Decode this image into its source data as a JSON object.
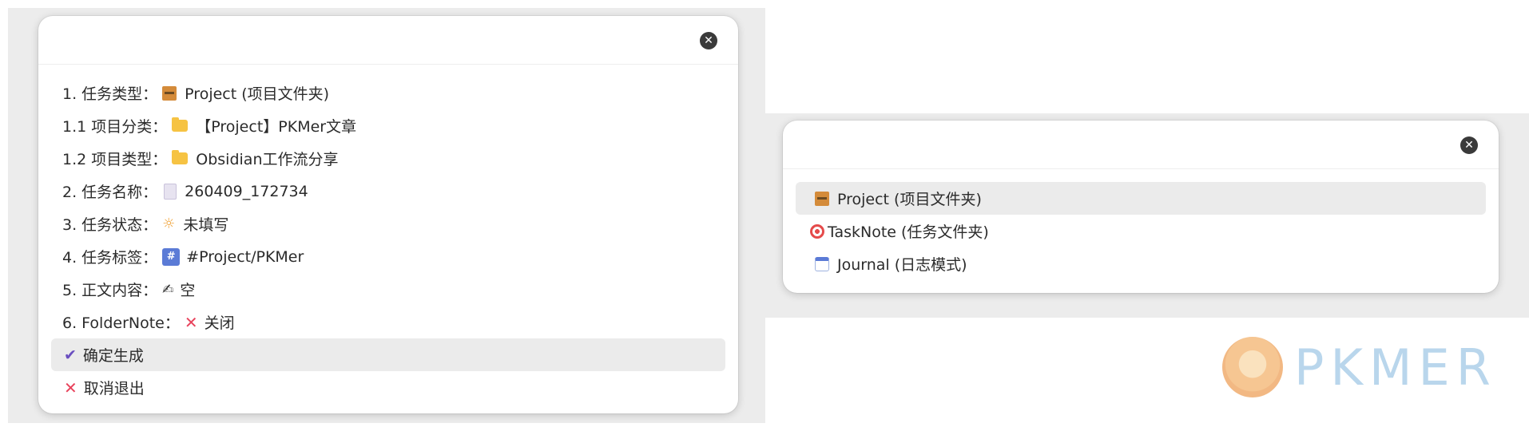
{
  "left_dialog": {
    "items": [
      {
        "prefix": "1. 任务类型：",
        "icon": "file-cabinet-icon",
        "value": "Project (项目文件夹)"
      },
      {
        "prefix": "1.1 项目分类：",
        "icon": "folder-icon",
        "value": "【Project】PKMer文章"
      },
      {
        "prefix": "1.2 项目类型：",
        "icon": "folder-icon",
        "value": "Obsidian工作流分享"
      },
      {
        "prefix": "2. 任务名称：",
        "icon": "page-icon",
        "value": "260409_172734"
      },
      {
        "prefix": "3. 任务状态：",
        "icon": "sun-icon",
        "value": "未填写"
      },
      {
        "prefix": "4. 任务标签：",
        "icon": "hash-icon",
        "value": "#Project/PKMer"
      },
      {
        "prefix": "5. 正文内容：",
        "icon": "writing-hand-icon",
        "value": "空"
      },
      {
        "prefix": "6. FolderNote：",
        "icon": "cross-mark-icon",
        "value": "关闭"
      }
    ],
    "confirm_label": "确定生成",
    "cancel_label": "取消退出"
  },
  "right_dialog": {
    "options": [
      {
        "icon": "file-cabinet-icon",
        "label": "Project (项目文件夹)",
        "selected": true
      },
      {
        "icon": "target-icon",
        "label": "TaskNote (任务文件夹)",
        "selected": false
      },
      {
        "icon": "calendar-icon",
        "label": "Journal (日志模式)",
        "selected": false
      }
    ]
  },
  "watermark": {
    "text": "PKMER"
  },
  "colors": {
    "selected_row": "#ebebeb",
    "accent_check": "#6a4fc0",
    "cross": "#e8435c"
  }
}
